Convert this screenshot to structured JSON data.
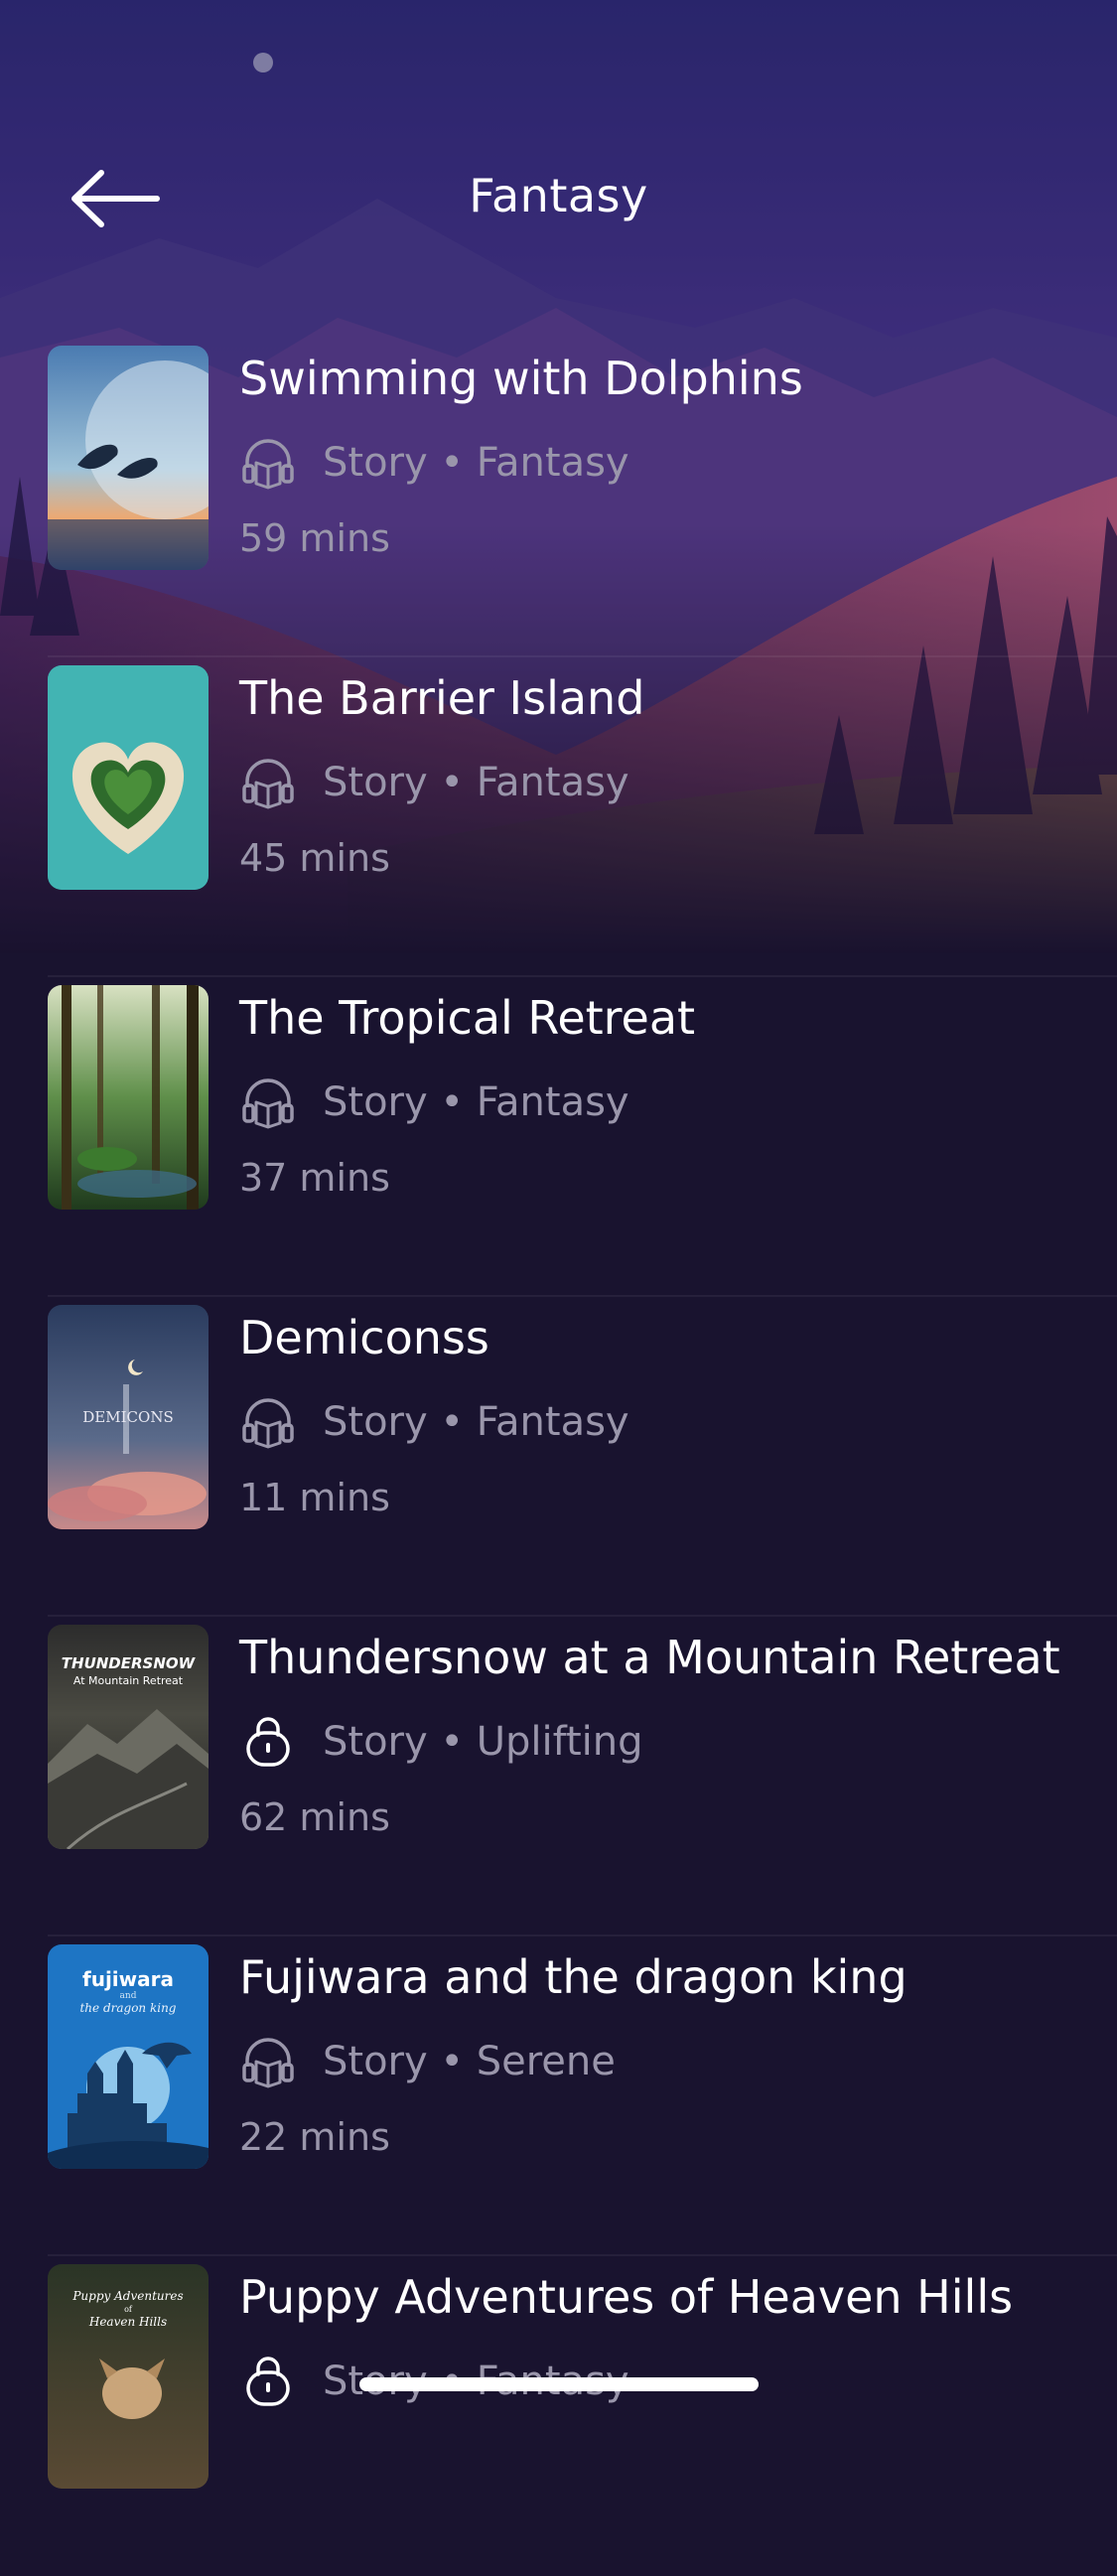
{
  "header": {
    "title": "Fantasy"
  },
  "items": [
    {
      "title": "Swimming with Dolphins",
      "meta": "Story • Fantasy",
      "duration": "59 mins",
      "access_icon": "headphones-book-icon"
    },
    {
      "title": "The Barrier Island",
      "meta": "Story • Fantasy",
      "duration": "45 mins",
      "access_icon": "headphones-book-icon"
    },
    {
      "title": "The Tropical Retreat",
      "meta": "Story • Fantasy",
      "duration": "37 mins",
      "access_icon": "headphones-book-icon"
    },
    {
      "title": "Demiconss",
      "meta": "Story • Fantasy",
      "duration": "11 mins",
      "access_icon": "headphones-book-icon",
      "cover_text": "DEMICONS"
    },
    {
      "title": "Thundersnow at a Mountain Retreat",
      "meta": "Story • Uplifting",
      "duration": "62 mins",
      "access_icon": "lock-icon",
      "cover_text": "THUNDERSNOW",
      "cover_subtext": "At Mountain Retreat"
    },
    {
      "title": "Fujiwara and the dragon king",
      "meta": "Story • Serene",
      "duration": "22 mins",
      "access_icon": "headphones-book-icon",
      "cover_text": "fujiwara",
      "cover_subtext": "and",
      "cover_subtext2": "the dragon king"
    },
    {
      "title": "Puppy Adventures of Heaven Hills",
      "meta": "Story • Fantasy",
      "duration": "",
      "access_icon": "lock-icon",
      "cover_text": "Puppy Adventures",
      "cover_subtext": "of",
      "cover_subtext2": "Heaven Hills"
    }
  ],
  "colors": {
    "background": "#19132f",
    "secondary_text": "#9a96ab",
    "primary_text": "#ffffff"
  }
}
